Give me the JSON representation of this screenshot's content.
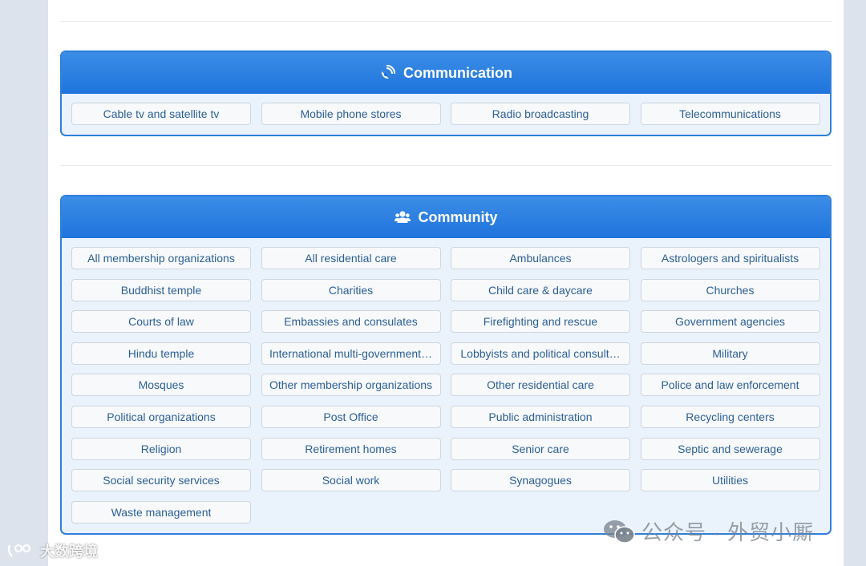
{
  "communication": {
    "title": "Communication",
    "icon": "satellite-dish-icon",
    "items": [
      "Cable tv and satellite tv",
      "Mobile phone stores",
      "Radio broadcasting",
      "Telecommunications"
    ]
  },
  "community": {
    "title": "Community",
    "icon": "users-icon",
    "items": [
      "All membership organizations",
      "All residential care",
      "Ambulances",
      "Astrologers and spiritualists",
      "Buddhist temple",
      "Charities",
      "Child care & daycare",
      "Churches",
      "Courts of law",
      "Embassies and consulates",
      "Firefighting and rescue",
      "Government agencies",
      "Hindu temple",
      "International multi-government…",
      "Lobbyists and political consult…",
      "Military",
      "Mosques",
      "Other membership organizations",
      "Other residential care",
      "Police and law enforcement",
      "Political organizations",
      "Post Office",
      "Public administration",
      "Recycling centers",
      "Religion",
      "Retirement homes",
      "Senior care",
      "Septic and sewerage",
      "Social security services",
      "Social work",
      "Synagogues",
      "Utilities",
      "Waste management"
    ]
  },
  "watermarks": {
    "left": "大数跨境",
    "right": "公众号 · 外贸小厮"
  },
  "colors": {
    "header_blue": "#1f74dc",
    "item_text": "#2b5f96",
    "card_bg": "#eaf2fb"
  }
}
